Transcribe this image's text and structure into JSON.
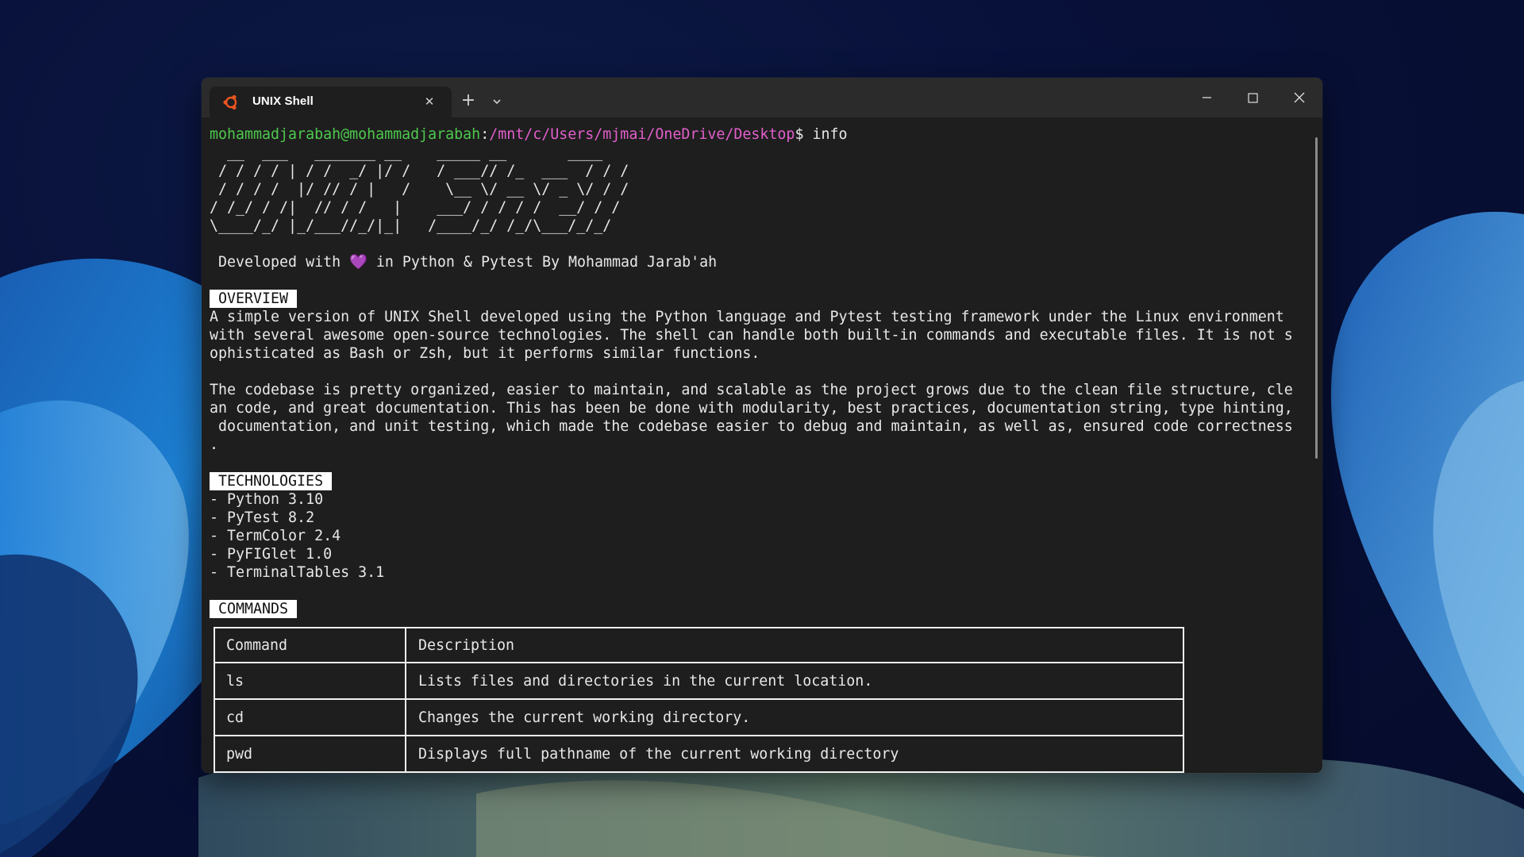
{
  "window": {
    "tab_title": "UNIX Shell",
    "tab_close": "✕",
    "new_tab": "+"
  },
  "terminal": {
    "prompt_user": "mohammadjarabah@mohammadjarabah",
    "prompt_sep": ":",
    "prompt_path": "/mnt/c/Users/mjmai/OneDrive/Desktop",
    "prompt_end": "$ ",
    "command": "info",
    "banner": [
      "  __  ___   _______ __    _____ __       ____ ",
      " / / / / | / /  _/ |/ /   / ___// /_  ___  / / /",
      " / / / /  |/ // / |   /    \\__ \\/ __ \\/ _ \\/ / / ",
      "/ /_/ / /|  // / /   |    ___/ / / / /  __/ / /  ",
      "\\____/_/ |_/___//_/|_|   /____/_/ /_/\\___/_/_/   "
    ],
    "developed_line": " Developed with 💜 in Python & Pytest By Mohammad Jarab'ah",
    "overview_heading": "OVERVIEW",
    "overview_lines": [
      "A simple version of UNIX Shell developed using the Python language and Pytest testing framework under the Linux environment",
      "with several awesome open-source technologies. The shell can handle both built-in commands and executable files. It is not s",
      "ophisticated as Bash or Zsh, but it performs similar functions.",
      "",
      "The codebase is pretty organized, easier to maintain, and scalable as the project grows due to the clean file structure, cle",
      "an code, and great documentation. This has been be done with modularity, best practices, documentation string, type hinting,",
      " documentation, and unit testing, which made the codebase easier to debug and maintain, as well as, ensured code correctness",
      "."
    ],
    "technologies_heading": "TECHNOLOGIES",
    "technologies": [
      "- Python 3.10",
      "- PyTest 8.2",
      "- TermColor 2.4",
      "- PyFIGlet 1.0",
      "- TerminalTables 3.1"
    ],
    "commands_heading": "COMMANDS",
    "commands_table": {
      "headers": [
        "Command",
        "Description"
      ],
      "rows": [
        [
          "ls",
          "Lists files and directories in the current location."
        ],
        [
          "cd",
          "Changes the current working directory."
        ],
        [
          "pwd",
          "Displays full pathname of the current working directory"
        ]
      ]
    }
  },
  "colors": {
    "prompt_user": "#4ec94e",
    "prompt_path": "#e35fcc",
    "terminal_bg": "#1e1e1e",
    "titlebar_bg": "#2b2b2b"
  },
  "icons": {
    "tab_icon": "ubuntu-logo-icon",
    "window_controls": [
      "minimize-icon",
      "maximize-icon",
      "close-icon"
    ]
  }
}
